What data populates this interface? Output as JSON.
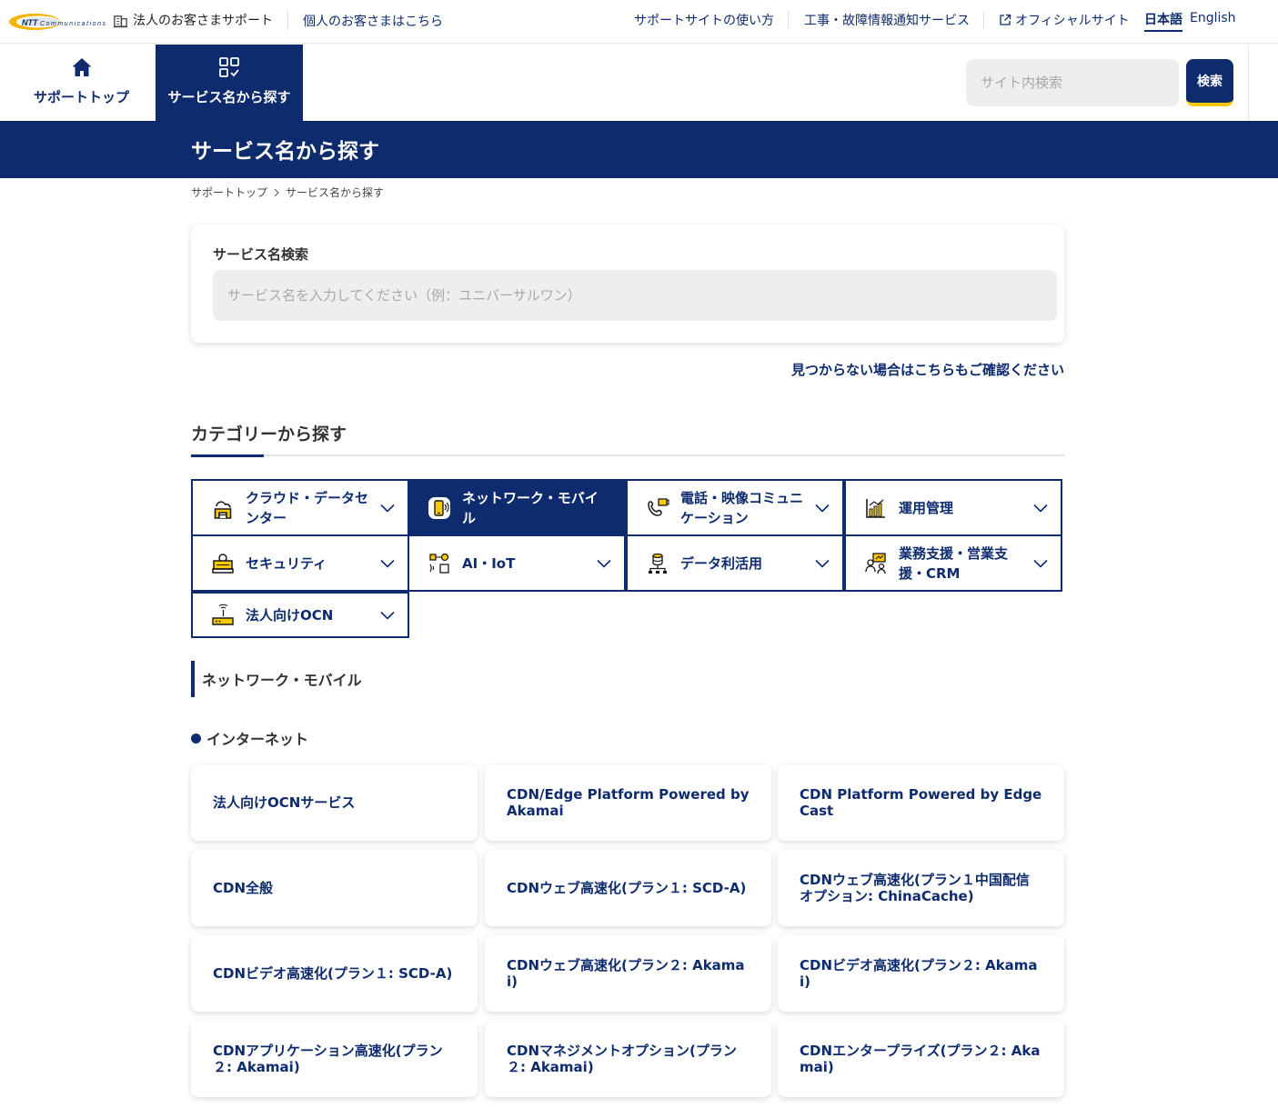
{
  "utility": {
    "logo_text": "NTT Communications",
    "corp_label": "法人のお客さまサポート",
    "personal_label": "個人のお客さまはこちら",
    "howto_label": "サポートサイトの使い方",
    "notice_label": "工事・故障情報通知サービス",
    "official_label": "オフィシャルサイト",
    "lang_ja": "日本語",
    "lang_en": "English"
  },
  "header": {
    "tab_top_label": "サポートトップ",
    "tab_service_label": "サービス名から探す",
    "search_placeholder": "サイト内検索",
    "search_button_label": "検索"
  },
  "page": {
    "title": "サービス名から探す",
    "breadcrumb": [
      "サポートトップ",
      "サービス名から探す"
    ]
  },
  "service_search": {
    "label": "サービス名検索",
    "placeholder": "サービス名を入力してください（例：ユニバーサルワン）",
    "not_found_link": "見つからない場合はこちらもご確認ください"
  },
  "categories": {
    "heading": "カテゴリーから探す",
    "items": [
      {
        "label": "クラウド・データセンター",
        "icon": "cloud-building-icon"
      },
      {
        "label": "ネットワーク・モバイル",
        "icon": "mobile-network-icon",
        "active": true
      },
      {
        "label": "電話・映像コミュニケーション",
        "icon": "phone-video-icon"
      },
      {
        "label": "運用管理",
        "icon": "bar-chart-icon"
      },
      {
        "label": "セキュリティ",
        "icon": "security-icon"
      },
      {
        "label": "AI・IoT",
        "icon": "ai-iot-icon"
      },
      {
        "label": "データ利活用",
        "icon": "data-icon"
      },
      {
        "label": "業務支援・営業支援・CRM",
        "icon": "crm-icon"
      },
      {
        "label": "法人向けOCN",
        "icon": "router-icon"
      }
    ]
  },
  "section": {
    "title": "ネットワーク・モバイル",
    "group": "インターネット",
    "services": [
      "法人向けOCNサービス",
      "CDN/Edge Platform Powered by Akamai",
      "CDN Platform Powered by Edge Cast",
      "CDN全般",
      "CDNウェブ高速化(プラン１: SCD-A)",
      "CDNウェブ高速化(プラン１中国配信オプション: ChinaCache)",
      "CDNビデオ高速化(プラン１: SCD-A)",
      "CDNウェブ高速化(プラン２: Akamai)",
      "CDNビデオ高速化(プラン２: Akamai)",
      "CDNアプリケーション高速化(プラン２: Akamai)",
      "CDNマネジメントオプション(プラン２: Akamai)",
      "CDNエンタープライズ(プラン２: Akamai)"
    ]
  },
  "colors": {
    "brand_navy": "#0e2b6e",
    "accent_yellow": "#f6c900",
    "input_bg": "#eeeeee"
  }
}
